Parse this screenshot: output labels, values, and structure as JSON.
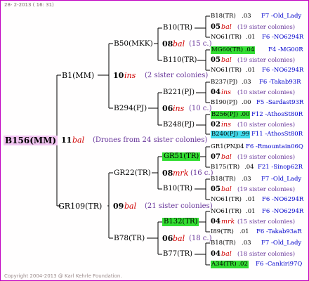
{
  "header": {
    "date_text": "28- 2-2013 ( 16: 31)"
  },
  "footer": {
    "copyright": "Copyright 2004-2013 @ Karl Kehrle Foundation."
  },
  "colors": {
    "border": "#c000c0",
    "root_bg": "#f2c6f2",
    "green": "#33dd33",
    "cyan": "#44ddee",
    "red": "#d00000",
    "blue": "#0000cc",
    "purple": "#663399"
  },
  "root": {
    "id": "B156(MM)",
    "year": "11",
    "breeder": "bal",
    "note": "(Drones from 24 sister colonies)"
  },
  "gen1": {
    "sire": {
      "id": "B1(MM)",
      "year": "10",
      "breeder": "ins",
      "note": "(2 sister colonies)"
    },
    "dam": {
      "id": "GR109(TR)",
      "year": "09",
      "breeder": "bal",
      "note": "(21 sister colonies)"
    }
  },
  "gen2": {
    "ss": {
      "id": "B50(MKK)",
      "year": "08",
      "breeder": "bal",
      "note": "(15 c.)"
    },
    "sd": {
      "id": "B294(PJ)",
      "year": "06",
      "breeder": "ins",
      "note": "(10 c.)"
    },
    "ds": {
      "id": "GR22(TR)",
      "year": "08",
      "breeder": "mrk",
      "note": "(16 c.)"
    },
    "dd": {
      "id": "B78(TR)",
      "year": "06",
      "breeder": "bal",
      "note": "(18 c.)"
    }
  },
  "gen3": [
    {
      "id": "B10(TR)",
      "year": "05",
      "breeder": "bal",
      "note": "(19 sister colonies)"
    },
    {
      "id": "B110(TR)",
      "year": "05",
      "breeder": "bal",
      "note": "(19 sister colonies)"
    },
    {
      "id": "B221(PJ)",
      "year": "04",
      "breeder": "ins",
      "note": "(10 sister colonies)"
    },
    {
      "id": "B248(PJ)",
      "year": "02",
      "breeder": "ins",
      "note": "(10 sister colonies)"
    },
    {
      "id": "GR51(TR)",
      "year": "07",
      "breeder": "bal",
      "note": "(19 sister colonies)"
    },
    {
      "id": "B10(TR)",
      "year": "05",
      "breeder": "bal",
      "note": "(19 sister colonies)"
    },
    {
      "id": "B132(TR)",
      "year": "04",
      "breeder": "mrk",
      "note": "(15 sister colonies)"
    },
    {
      "id": "B77(TR)",
      "year": "04",
      "breeder": "bal",
      "note": "(18 sister colonies)"
    }
  ],
  "gen4": [
    {
      "id": "B18(TR)",
      "year": ".03",
      "info": "F7 -Old_Lady"
    },
    {
      "id": "NO61(TR)",
      "year": ".01",
      "info": "F6 -NO6294R"
    },
    {
      "id": "MG60(TR)",
      "year": ".04",
      "info": "F4 -MG00R"
    },
    {
      "id": "NO61(TR)",
      "year": ".01",
      "info": "F6 -NO6294R"
    },
    {
      "id": "B237(PJ)",
      "year": ".03",
      "info": "F6 -Takab93R"
    },
    {
      "id": "B190(PJ)",
      "year": ".00",
      "info": "F5 -Sardast93R"
    },
    {
      "id": "B256(PJ)",
      "year": ".00",
      "info": "F12 -AthosSt80R"
    },
    {
      "id": "B240(PJ)",
      "year": ".99",
      "info": "F11 -AthosSt80R"
    },
    {
      "id": "GR1(PN)",
      "year": ".04",
      "info": "F6 -Rmountain06Q"
    },
    {
      "id": "B175(TR)",
      "year": ".04",
      "info": "F21 -Sinop62R"
    },
    {
      "id": "B18(TR)",
      "year": ".03",
      "info": "F7 -Old_Lady"
    },
    {
      "id": "NO61(TR)",
      "year": ".01",
      "info": "F6 -NO6294R"
    },
    {
      "id": "NO61(TR)",
      "year": ".01",
      "info": "F6 -NO6294R"
    },
    {
      "id": "I89(TR)",
      "year": ".01",
      "info": "F6 -Takab93aR"
    },
    {
      "id": "B18(TR)",
      "year": ".03",
      "info": "F7 -Old_Lady"
    },
    {
      "id": "A34(TR)",
      "year": ".02",
      "info": "F6 -Cankiri97Q"
    }
  ]
}
